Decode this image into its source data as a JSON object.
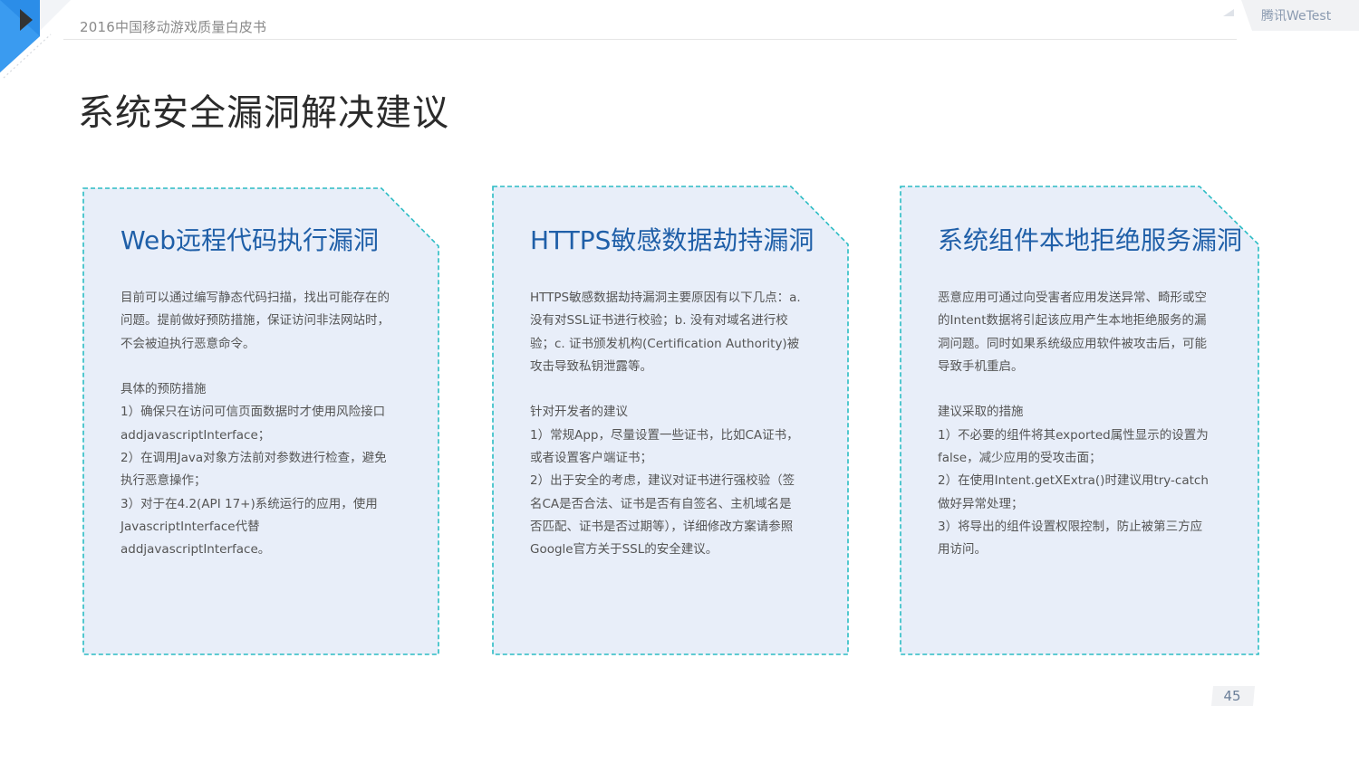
{
  "header": {
    "doc_title": "2016中国移动游戏质量白皮书",
    "brand": "腾讯WeTest"
  },
  "page_title": "系统安全漏洞解决建议",
  "cards": [
    {
      "title": "Web远程代码执行漏洞",
      "lines": [
        "目前可以通过编写静态代码扫描，找出可能存在的",
        "问题。提前做好预防措施，保证访问非法网站时，",
        "不会被迫执行恶意命令。",
        "",
        "具体的预防措施",
        "1）确保只在访问可信页面数据时才使用风险接口",
        "addjavascriptInterface；",
        "2）在调用Java对象方法前对参数进行检查，避免",
        "执行恶意操作；",
        "3）对于在4.2(API 17+)系统运行的应用，使用",
        "JavascriptInterface代替",
        "addjavascriptInterface。"
      ]
    },
    {
      "title": "HTTPS敏感数据劫持漏洞",
      "lines": [
        "HTTPS敏感数据劫持漏洞主要原因有以下几点：a.",
        "没有对SSL证书进行校验；b. 没有对域名进行校",
        "验；c. 证书颁发机构(Certification Authority)被",
        "攻击导致私钥泄露等。",
        "",
        "针对开发者的建议",
        "1）常规App，尽量设置一些证书，比如CA证书，",
        "或者设置客户端证书；",
        "2）出于安全的考虑，建议对证书进行强校验（签",
        "名CA是否合法、证书是否有自签名、主机域名是",
        "否匹配、证书是否过期等），详细修改方案请参照",
        "Google官方关于SSL的安全建议。"
      ]
    },
    {
      "title": "系统组件本地拒绝服务漏洞",
      "lines": [
        "恶意应用可通过向受害者应用发送异常、畸形或空",
        "的Intent数据将引起该应用产生本地拒绝服务的漏",
        "洞问题。同时如果系统级应用软件被攻击后，可能",
        "导致手机重启。",
        "",
        "建议采取的措施",
        "1）不必要的组件将其exported属性显示的设置为",
        "false，减少应用的受攻击面；",
        "2）在使用Intent.getXExtra()时建议用try-catch",
        "做好异常处理；",
        "3）将导出的组件设置权限控制，防止被第三方应",
        "用访问。"
      ]
    }
  ],
  "page_number": "45",
  "colors": {
    "card_fill": "#e8eef9",
    "card_border": "#2bbcc4",
    "card_title": "#1f5fa8",
    "accent_blue": "#2b8de8",
    "accent_dark": "#3a3a3a"
  }
}
